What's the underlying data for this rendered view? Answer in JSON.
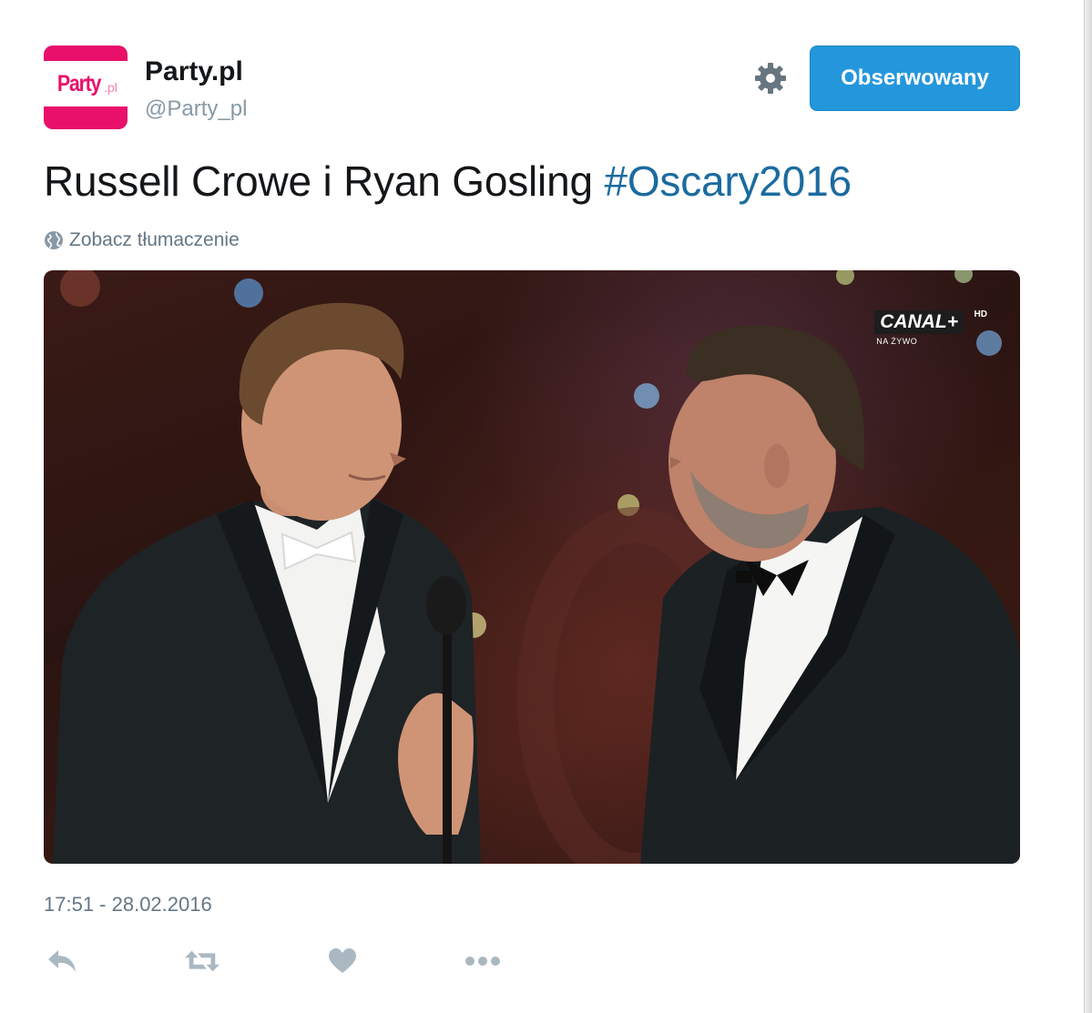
{
  "account": {
    "avatar_logo_main": "Party",
    "avatar_logo_sub": ".pl",
    "display_name": "Party.pl",
    "handle": "@Party_pl"
  },
  "header": {
    "follow_button_label": "Obserwowany",
    "settings_icon": "gear-icon"
  },
  "tweet": {
    "text": "Russell Crowe i Ryan Gosling ",
    "hashtag": "#Oscary2016",
    "translate_label": "Zobacz tłumaczenie",
    "translate_icon": "globe-icon",
    "timestamp": "17:51 - 28.02.2016"
  },
  "media": {
    "broadcaster": "CANAL+",
    "broadcaster_hd": "HD",
    "broadcaster_live": "NA ŻYWO"
  },
  "actions": [
    {
      "icon": "reply-icon"
    },
    {
      "icon": "retweet-icon"
    },
    {
      "icon": "heart-icon"
    },
    {
      "icon": "more-icon"
    }
  ],
  "colors": {
    "link": "#1b6b9f",
    "follow_button": "#2497dc",
    "brand_pink": "#e8106a",
    "muted_text": "#657786",
    "action_icon": "#aab8c2"
  }
}
